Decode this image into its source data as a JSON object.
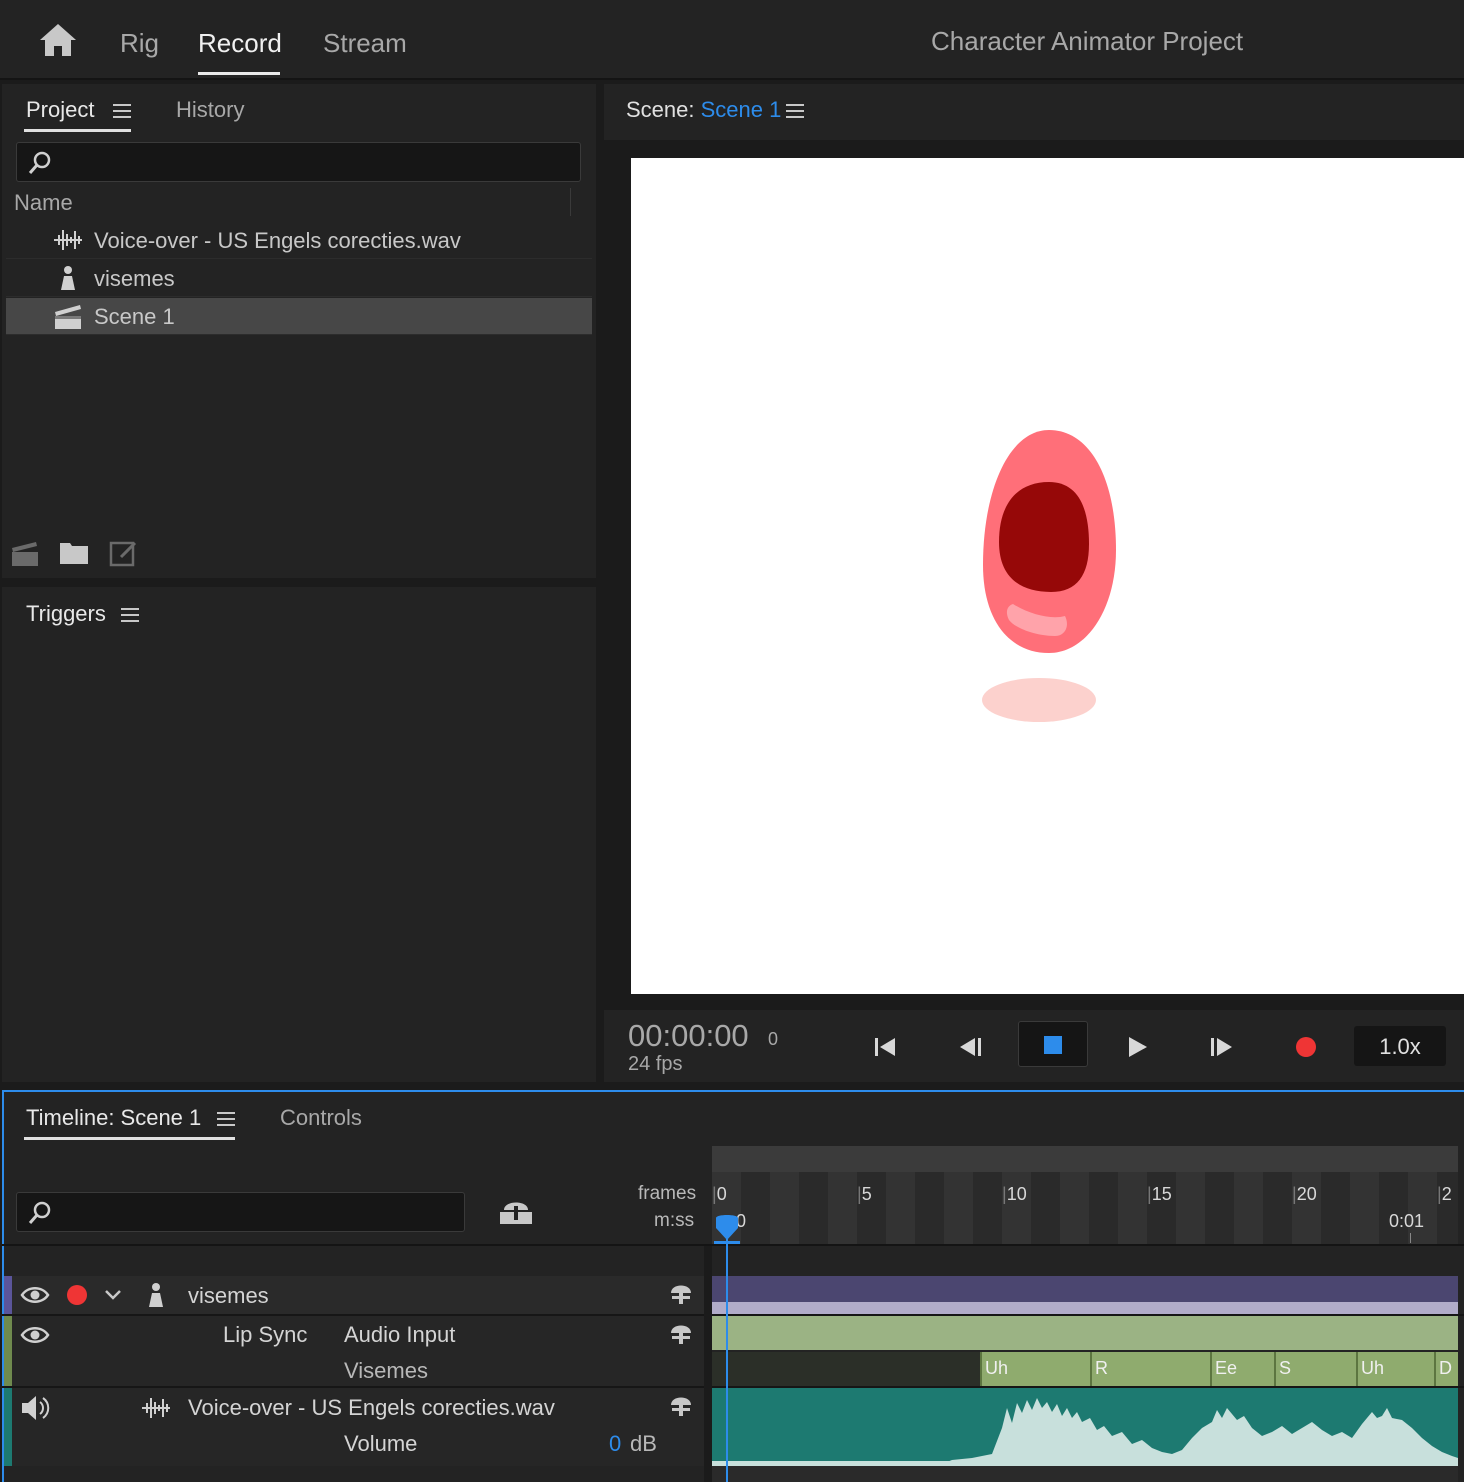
{
  "top_bar": {
    "tabs": [
      {
        "label": "Rig"
      },
      {
        "label": "Record"
      },
      {
        "label": "Stream"
      }
    ],
    "active_tab": "Record",
    "app_title": "Character Animator Project"
  },
  "project_panel": {
    "tabs": [
      {
        "label": "Project"
      },
      {
        "label": "History"
      }
    ],
    "search": {
      "value": "",
      "placeholder": ""
    },
    "column_header": "Name",
    "items": [
      {
        "label": "Voice-over - US Engels corecties.wav",
        "icon": "audio-waveform-icon",
        "selected": false
      },
      {
        "label": "visemes",
        "icon": "puppet-icon",
        "selected": false
      },
      {
        "label": "Scene 1",
        "icon": "clapperboard-icon",
        "selected": true
      }
    ],
    "footer_icons": [
      "new-scene-icon",
      "new-folder-icon",
      "new-item-icon"
    ]
  },
  "triggers_panel": {
    "title": "Triggers"
  },
  "scene_panel": {
    "label_prefix": "Scene:",
    "scene_name": "Scene 1",
    "accent_color": "#2d8ceb",
    "timecode": "00:00:00",
    "frame": "0",
    "fps": "24 fps",
    "speed": "1.0x",
    "controls": [
      "go-to-start-icon",
      "step-back-icon",
      "stop-icon",
      "play-icon",
      "step-forward-icon",
      "record-icon"
    ]
  },
  "timeline_panel": {
    "tabs": [
      {
        "label": "Timeline: Scene 1"
      },
      {
        "label": "Controls"
      }
    ],
    "search": {
      "value": "",
      "placeholder": ""
    },
    "ruler": {
      "frames_label": "frames",
      "mss_label": "m:ss",
      "frame_ticks": [
        "0",
        "5",
        "10",
        "15",
        "20",
        "2"
      ],
      "time_ticks": [
        "0",
        "0:01"
      ]
    },
    "tracks": {
      "puppet": {
        "name": "visemes",
        "color": "#4b4670"
      },
      "behavior": {
        "name": "Lip Sync",
        "param_audio": "Audio Input",
        "param_visemes": "Visemes"
      },
      "audio": {
        "name": "Voice-over - US Engels corecties.wav",
        "param": "Volume",
        "volume_value": "0",
        "volume_unit": "dB"
      }
    },
    "visemes": [
      "Uh",
      "R",
      "Ee",
      "S",
      "Uh",
      "D"
    ]
  }
}
